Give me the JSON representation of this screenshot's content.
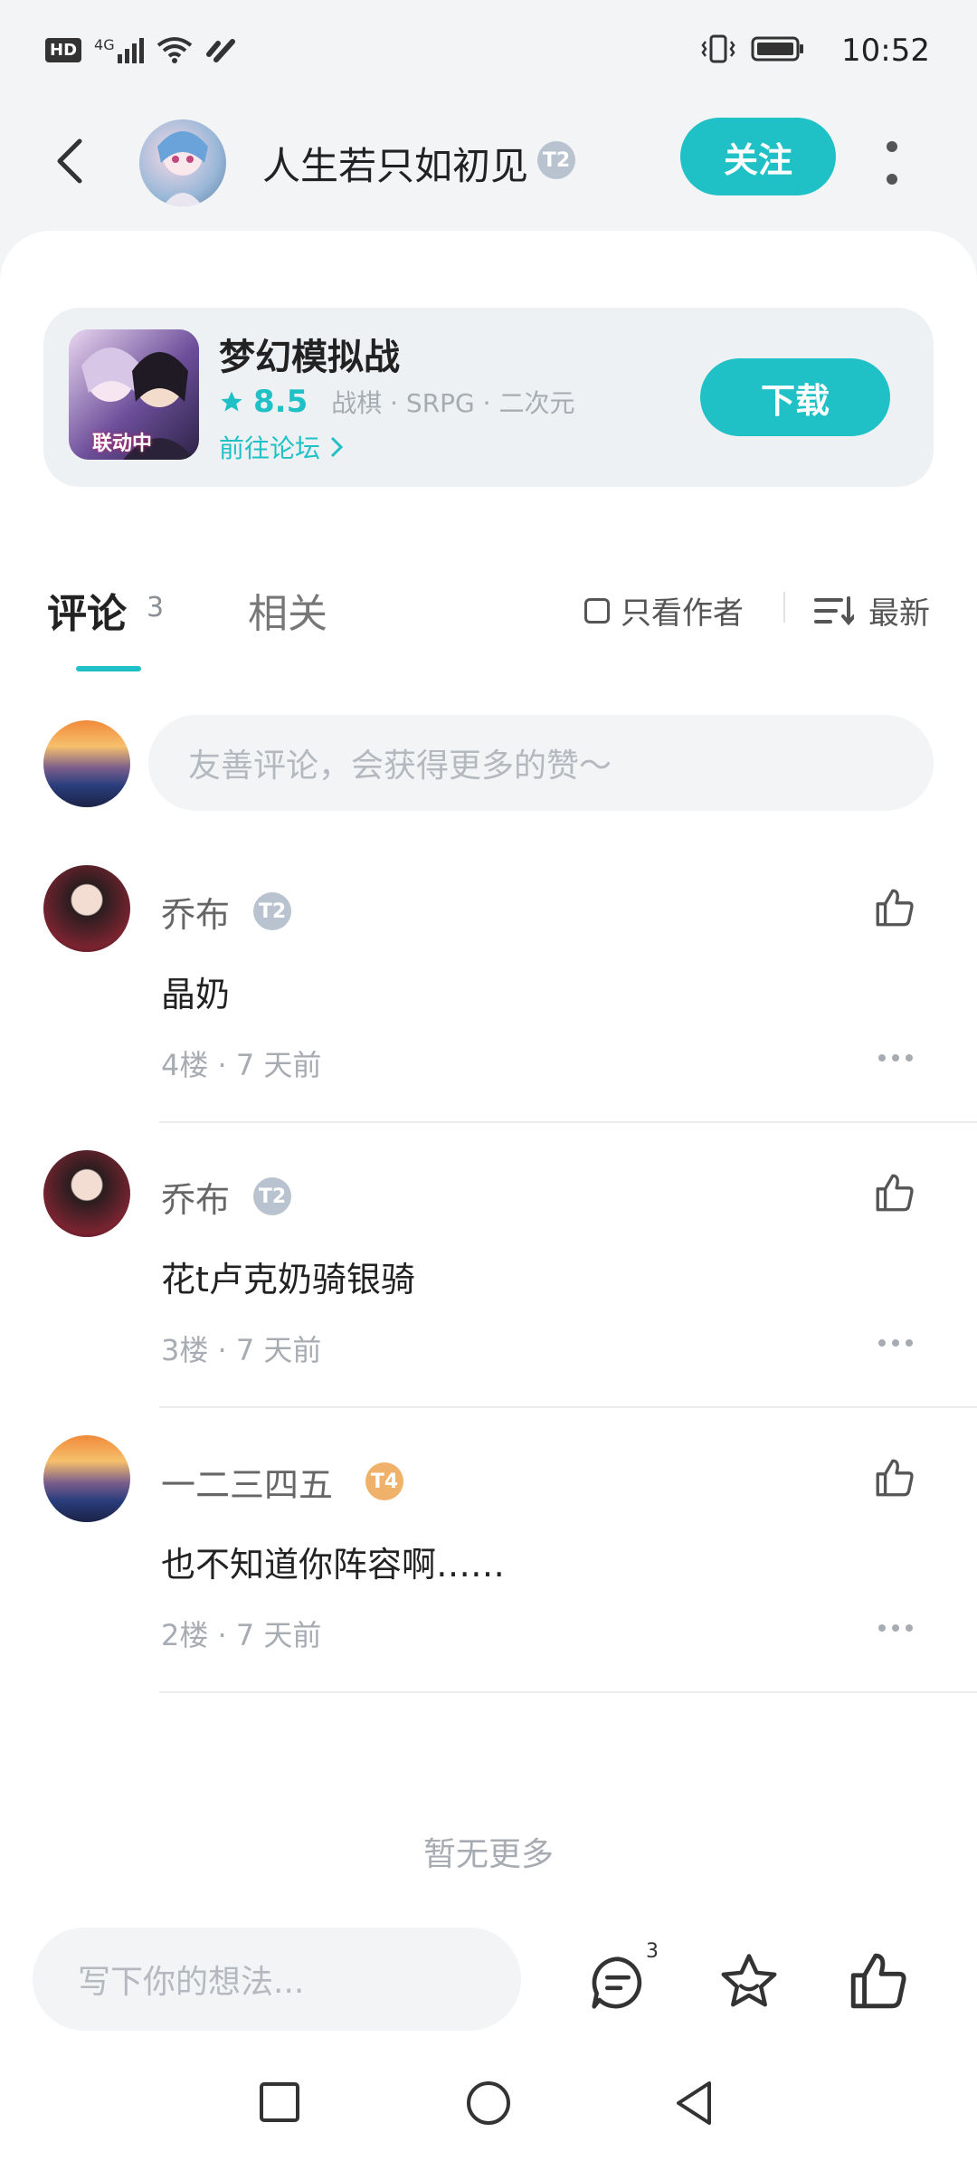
{
  "status_bar": {
    "hd": "HD",
    "network": "4G",
    "time": "10:52"
  },
  "header": {
    "title": "人生若只如初见",
    "tier": "T2",
    "follow_label": "关注"
  },
  "game": {
    "name": "梦幻模拟战",
    "rating": "8.5",
    "tags": "战棋 · SRPG · 二次元",
    "forum_link": "前往论坛",
    "download_label": "下载",
    "cover_text": "联动中"
  },
  "tabs": {
    "comments_label": "评论",
    "comments_count": "3",
    "related_label": "相关",
    "author_only_label": "只看作者",
    "sort_label": "最新"
  },
  "comment_box": {
    "placeholder": "友善评论，会获得更多的赞～"
  },
  "comments": [
    {
      "name": "乔布",
      "tier": "T2",
      "text": "晶奶",
      "meta": "4楼 · 7 天前"
    },
    {
      "name": "乔布",
      "tier": "T2",
      "text": "花t卢克奶骑银骑",
      "meta": "3楼 · 7 天前"
    },
    {
      "name": "一二三四五",
      "tier": "T4",
      "text": "也不知道你阵容啊……",
      "meta": "2楼 · 7 天前"
    }
  ],
  "end_text": "暂无更多",
  "bottom_bar": {
    "input_placeholder": "写下你的想法...",
    "comment_count": "3"
  },
  "colors": {
    "accent": "#1fc1c6",
    "tier_silver": "#b9c3cf",
    "tier_gold": "#f0b26a"
  }
}
